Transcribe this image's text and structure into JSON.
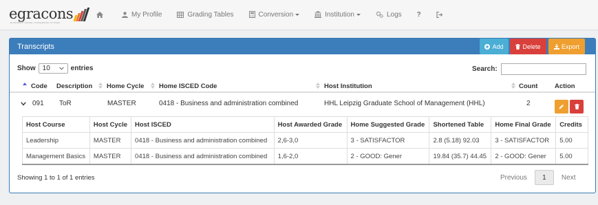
{
  "brand": {
    "name": "egracons",
    "tagline": "EUROPEAN GRADE CONVERSION SYSTEM",
    "bar_colors": [
      "#f4b400",
      "#e8772e",
      "#d9403b",
      "#5b5b5b",
      "#333333"
    ]
  },
  "nav": {
    "items": [
      {
        "label": "",
        "icon": "home-icon"
      },
      {
        "label": "My Profile",
        "icon": "user-icon"
      },
      {
        "label": "Grading Tables",
        "icon": "table-icon"
      },
      {
        "label": "Conversion",
        "icon": "calculator-icon"
      },
      {
        "label": "Institution",
        "icon": "institution-icon"
      },
      {
        "label": "Logs",
        "icon": "cogs-icon"
      },
      {
        "label": "?",
        "icon": ""
      },
      {
        "label": "",
        "icon": "sign-out-icon"
      }
    ]
  },
  "panel": {
    "title": "Transcripts",
    "add_label": "Add",
    "delete_label": "Delete",
    "export_label": "Export",
    "colors": {
      "header": "#3c7dbb",
      "add": "#4aaed5",
      "delete": "#d9403b",
      "export": "#ef9f30"
    }
  },
  "length": {
    "show_label": "Show",
    "selected": "10",
    "entries_label": "entries"
  },
  "search": {
    "label": "Search:",
    "value": ""
  },
  "columns": {
    "code": "Code",
    "description": "Description",
    "home_cycle": "Home Cycle",
    "home_isced": "Home ISCED Code",
    "host_institution": "Host Institution",
    "count": "Count",
    "action": "Action"
  },
  "row": {
    "code": "091",
    "description": "ToR",
    "home_cycle": "MASTER",
    "home_isced": "0418 - Business and administration combined",
    "host_institution": "HHL Leipzig Graduate School of Management (HHL)",
    "count": "2"
  },
  "sub_table": {
    "headers": [
      "Host Course",
      "Host Cycle",
      "Host ISCED",
      "Host Awarded Grade",
      "Home Suggested Grade",
      "Shortened Table",
      "Home Final Grade",
      "Credits"
    ],
    "rows": [
      [
        "Leadership",
        "MASTER",
        "0418 - Business and administration combined",
        "2,6-3,0",
        "3 - SATISFACTOR",
        "2.8 (5.18) 92.03",
        "3 - SATISFACTOR",
        "5.00"
      ],
      [
        "Management Basics",
        "MASTER",
        "0418 - Business and administration combined",
        "1,6-2,0",
        "2 - GOOD: Gener",
        "19.84 (35.7) 44.45",
        "2 - GOOD: Gener",
        "5.00"
      ]
    ]
  },
  "footer": {
    "info": "Showing 1 to 1 of 1 entries",
    "previous": "Previous",
    "current_page": "1",
    "next": "Next"
  }
}
